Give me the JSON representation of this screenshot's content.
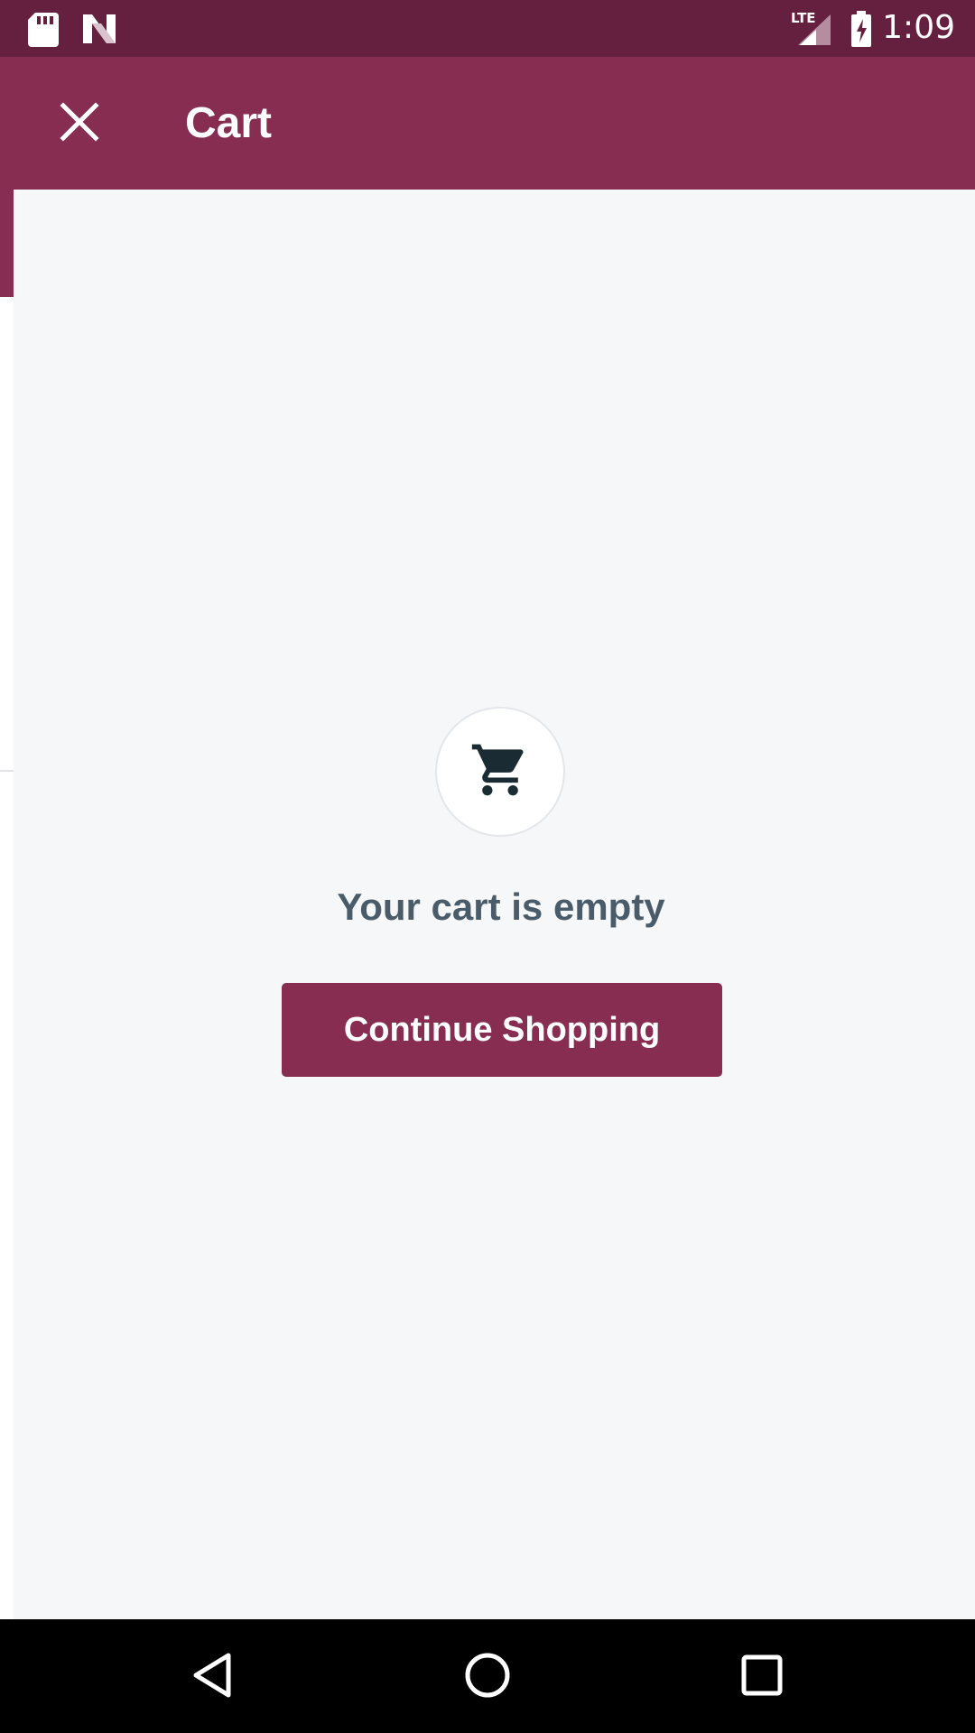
{
  "status_bar": {
    "time": "1:09",
    "left_icons": [
      "sd-card-icon",
      "n-logo-icon"
    ],
    "right_icons": [
      "lte-signal-icon",
      "battery-charging-icon"
    ],
    "background_color": "#66203f"
  },
  "app_bar": {
    "title": "Cart",
    "close_icon": "close-icon",
    "background_color": "#862d51"
  },
  "empty_state": {
    "icon": "shopping-cart-icon",
    "message": "Your cart is empty",
    "button_label": "Continue Shopping",
    "text_color": "#4a5c69",
    "button_color": "#862d51"
  },
  "nav_bar": {
    "buttons": [
      "back-icon",
      "home-icon",
      "recents-icon"
    ]
  }
}
